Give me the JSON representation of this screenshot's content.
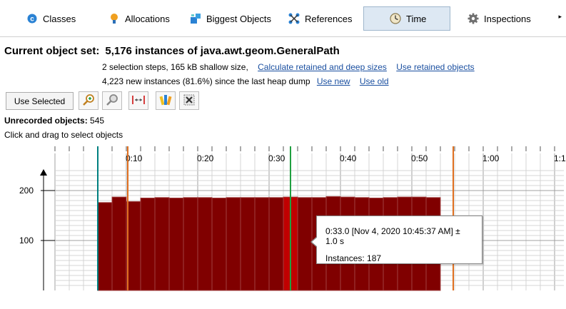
{
  "tabs": [
    {
      "label": "Classes",
      "icon": "classes-icon",
      "active": false
    },
    {
      "label": "Allocations",
      "icon": "allocations-icon",
      "active": false
    },
    {
      "label": "Biggest Objects",
      "icon": "biggest-objects-icon",
      "active": false
    },
    {
      "label": "References",
      "icon": "references-icon",
      "active": false
    },
    {
      "label": "Time",
      "icon": "clock-icon",
      "active": true
    },
    {
      "label": "Inspections",
      "icon": "gear-icon",
      "active": false
    }
  ],
  "tabs_more": "▸",
  "header": {
    "label": "Current object set:",
    "value": "5,176 instances of java.awt.geom.GeneralPath",
    "info1": "2 selection steps, 165 kB shallow size,",
    "link_retained": "Calculate retained and deep sizes",
    "link_use_retained": "Use retained objects",
    "info2": "4,223 new instances (81.6%) since the last heap dump",
    "link_use_new": "Use new",
    "link_use_old": "Use old"
  },
  "toolbar": {
    "use_selected": "Use Selected",
    "icons": [
      "zoom-in-icon",
      "zoom-out-icon",
      "fit-width-icon",
      "color-icon",
      "clear-selection-icon"
    ]
  },
  "unrecorded": {
    "label": "Unrecorded objects:",
    "value": "545"
  },
  "hint": "Click and drag to select objects",
  "tooltip": {
    "line1": "0:33.0 [Nov 4, 2020 10:45:37 AM] ± 1.0 s",
    "instances_label": "Instances:",
    "instances_value": "187"
  },
  "chart_data": {
    "type": "bar",
    "x_ticks": [
      "0:10",
      "0:20",
      "0:30",
      "0:40",
      "0:50",
      "1:00",
      "1:10"
    ],
    "y_ticks": [
      "100",
      "200"
    ],
    "x_unit_seconds_per_bar": 2,
    "start_seconds": 6,
    "values": [
      176,
      187,
      178,
      185,
      186,
      185,
      186,
      186,
      185,
      186,
      186,
      186,
      186,
      187,
      186,
      186,
      188,
      187,
      186,
      185,
      186,
      187,
      187,
      186
    ],
    "highlight_index": 13,
    "highlight_color": "#c00000",
    "bar_color": "#800000",
    "bar_border": "#a04040",
    "markers": [
      {
        "seconds": 6,
        "color": "#008080"
      },
      {
        "seconds": 10.2,
        "color": "#e07020"
      },
      {
        "seconds": 33,
        "color": "#20a040"
      },
      {
        "seconds": 55.8,
        "color": "#e07020"
      }
    ],
    "ylim": [
      0,
      240
    ],
    "xlim_seconds": [
      0,
      71
    ]
  }
}
